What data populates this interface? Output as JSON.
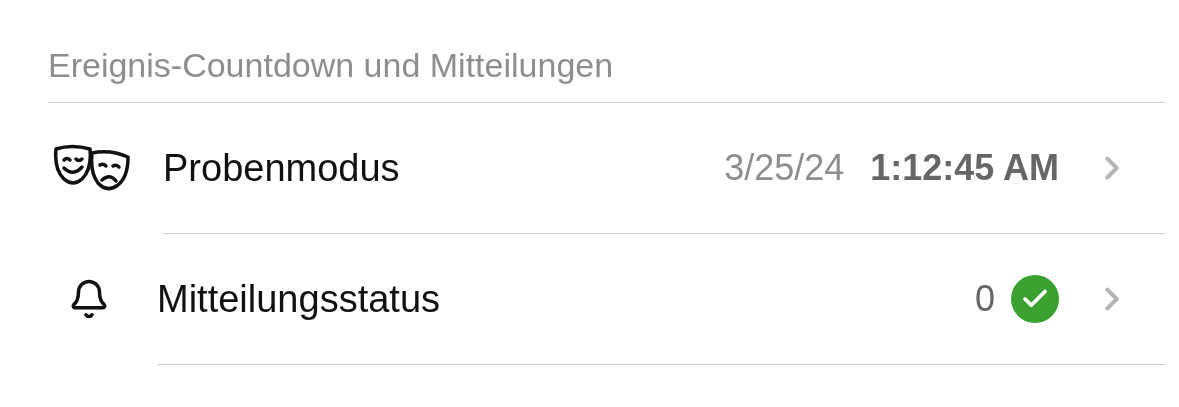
{
  "section": {
    "title": "Ereignis-Countdown und Mitteilungen"
  },
  "rows": [
    {
      "kind": "countdown",
      "label": "Probenmodus",
      "date": "3/25/24",
      "time": "1:12:45 AM"
    },
    {
      "kind": "status",
      "label": "Mitteilungsstatus",
      "count": "0",
      "ok": true
    }
  ]
}
